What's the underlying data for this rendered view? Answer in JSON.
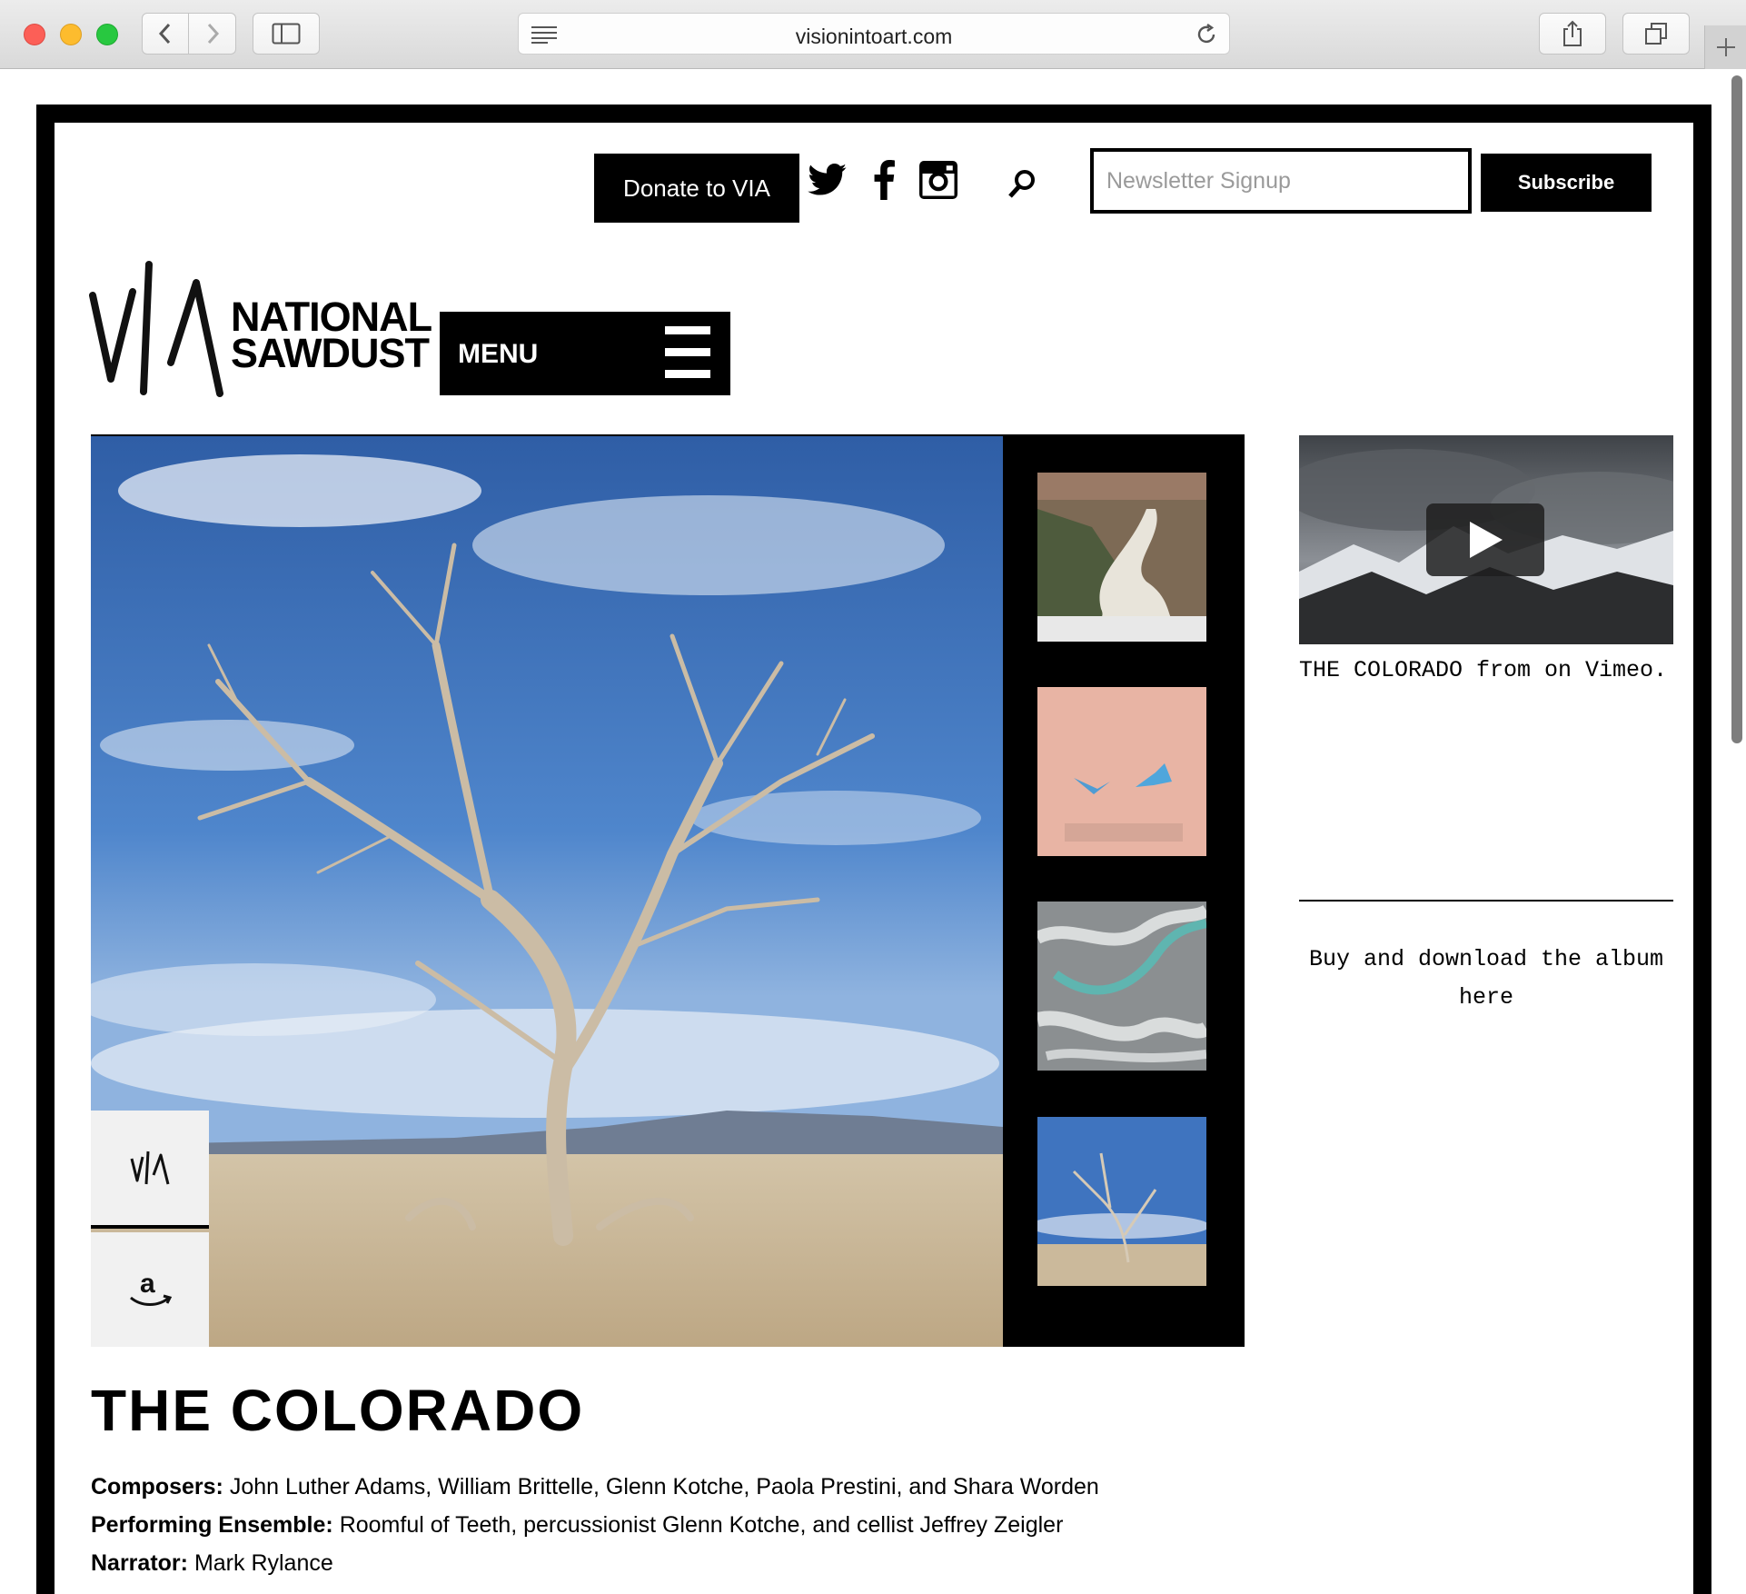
{
  "browser": {
    "url": "visionintoart.com",
    "icons": {
      "back": "chevron-left-icon",
      "forward": "chevron-right-icon",
      "sidebar": "sidebar-icon",
      "reader": "reader-icon",
      "reload": "reload-icon",
      "share": "share-icon",
      "tabs": "tabs-icon",
      "new_tab": "plus-icon"
    }
  },
  "topbar": {
    "donate_label": "Donate to VIA",
    "social_icons": [
      "twitter-icon",
      "facebook-icon",
      "instagram-icon"
    ],
    "search_icon": "search-icon",
    "newsletter_placeholder": "Newsletter Signup",
    "subscribe_label": "Subscribe"
  },
  "header": {
    "logo_line1": "NATIONAL",
    "logo_line2": "SAWDUST",
    "menu_label": "MENU"
  },
  "slideshow": {
    "store_icons": [
      "via-icon",
      "amazon-icon"
    ],
    "thumbnail_count": 4
  },
  "sidebar": {
    "video_caption": "THE COLORADO from on Vimeo.",
    "buy_link": "Buy and download the album here"
  },
  "album": {
    "title": "THE COLORADO",
    "credits": [
      {
        "label": "Composers:",
        "value": "John Luther Adams, William Brittelle, Glenn Kotche, Paola Prestini, and Shara Worden"
      },
      {
        "label": "Performing Ensemble:",
        "value": "Roomful of Teeth, percussionist Glenn Kotche, and cellist Jeffrey Zeigler"
      },
      {
        "label": "Narrator:",
        "value": "Mark Rylance"
      }
    ]
  },
  "colors": {
    "accent": "#000000",
    "background": "#ffffff",
    "sky": "#3f77c0",
    "desert": "#cdb99b"
  }
}
